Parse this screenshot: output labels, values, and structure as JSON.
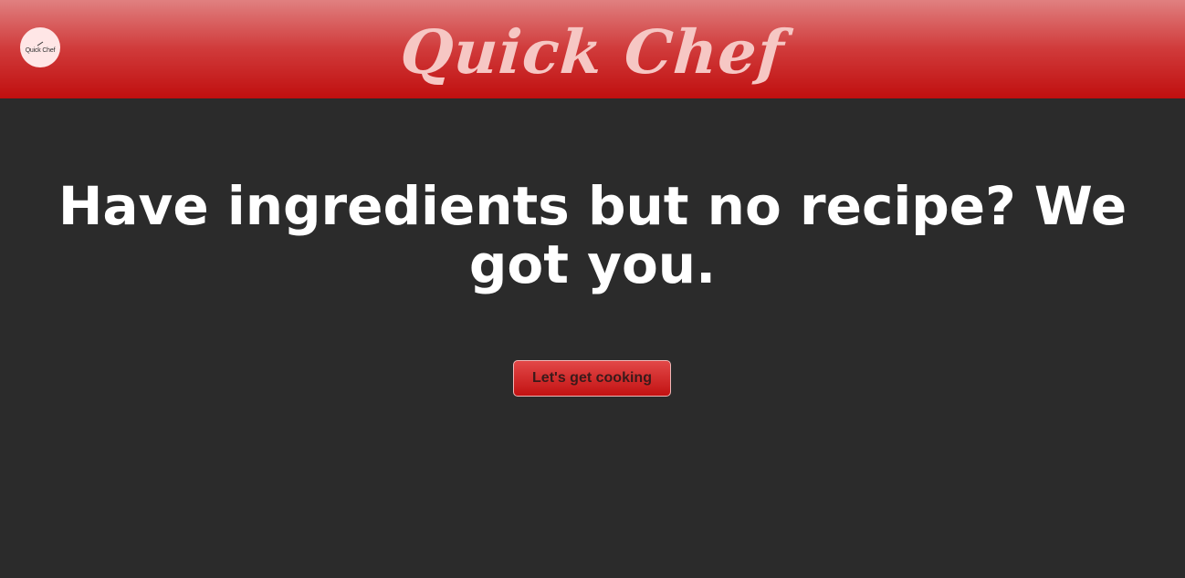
{
  "header": {
    "logo_text": "Quick Chef",
    "brand_title": "Quick Chef"
  },
  "hero": {
    "headline": "Have ingredients but no recipe? We got you."
  },
  "cta": {
    "label": "Let's get cooking"
  },
  "colors": {
    "page_background": "#2b2b2b",
    "header_top": "#e08080",
    "header_bottom": "#c00f0f",
    "brand_text": "#f6c7c4",
    "logo_background": "#ffe6e6",
    "button_top": "#e24848",
    "button_bottom": "#c21212"
  }
}
